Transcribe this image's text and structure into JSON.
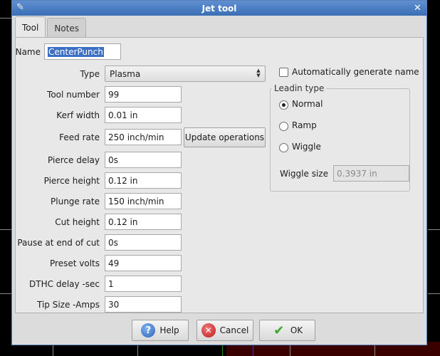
{
  "window": {
    "title": "Jet tool"
  },
  "tabs": [
    {
      "label": "Tool"
    },
    {
      "label": "Notes"
    }
  ],
  "form": {
    "name": {
      "label": "Name",
      "value": "CenterPunch"
    },
    "type": {
      "label": "Type",
      "value": "Plasma"
    },
    "tool_number": {
      "label": "Tool number",
      "value": "99"
    },
    "kerf_width": {
      "label": "Kerf width",
      "value": "0.01 in"
    },
    "feed_rate": {
      "label": "Feed rate",
      "value": "250 inch/min"
    },
    "update_operations": "Update operations",
    "pierce_delay": {
      "label": "Pierce delay",
      "value": "0s"
    },
    "pierce_height": {
      "label": "Pierce height",
      "value": "0.12 in"
    },
    "plunge_rate": {
      "label": "Plunge rate",
      "value": "150 inch/min"
    },
    "cut_height": {
      "label": "Cut height",
      "value": "0.12 in"
    },
    "pause_end": {
      "label": "Pause at end of cut",
      "value": "0s"
    },
    "preset_volts": {
      "label": "Preset volts",
      "value": "49"
    },
    "dthc_delay": {
      "label": "DTHC delay -sec",
      "value": "1"
    },
    "tip_size": {
      "label": "Tip Size -Amps",
      "value": "30"
    }
  },
  "auto_name": {
    "label": "Automatically generate name",
    "checked": false
  },
  "leadin": {
    "title": "Leadin type",
    "options": [
      {
        "label": "Normal",
        "selected": true
      },
      {
        "label": "Ramp",
        "selected": false
      },
      {
        "label": "Wiggle",
        "selected": false
      }
    ],
    "wiggle_size": {
      "label": "Wiggle size",
      "value": "0.3937 in"
    }
  },
  "footer": {
    "help": "Help",
    "cancel": "Cancel",
    "ok": "OK"
  },
  "icons": {
    "app": "pencil-icon",
    "close": "close-icon",
    "help": "help-icon",
    "cancel": "cancel-icon",
    "ok": "checkmark-icon"
  }
}
